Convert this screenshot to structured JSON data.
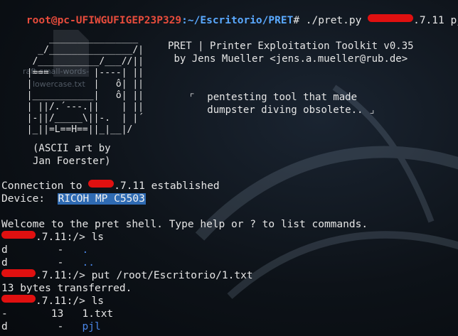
{
  "prompt": {
    "user_host": "root@pc-UFIWGUFIGEP23P329",
    "path": ":~/Escritorio/PRET",
    "symbol": "#",
    "command": "./pret.py",
    "ip_suffix": ".7.11",
    "protocol": "pjl"
  },
  "banner": {
    "title": "PRET | Printer Exploitation Toolkit v0.35",
    "author": "by Jens Mueller <jens.a.mueller@rub.de>",
    "tagline_1": "pentesting tool that made",
    "tagline_2": "dumpster diving obsolete.."
  },
  "ascii_credit": {
    "line1": "(ASCII art by",
    "line2": "Jan Foerster)"
  },
  "desktop_ghost": {
    "file1": "raft-small-words-",
    "file2": "lowercase.txt"
  },
  "connection": {
    "prefix": "Connection to",
    "ip_suffix": ".7.11",
    "status": "established",
    "device_label": "Device:",
    "device_name": "RICOH MP C5503"
  },
  "welcome": "Welcome to the pret shell. Type help or ? to list commands.",
  "session": {
    "shell_prompt": ".7.11:/>",
    "cmd1": "ls",
    "ls1_rows": [
      {
        "type": "d",
        "size": "-",
        "name": "."
      },
      {
        "type": "d",
        "size": "-",
        "name": ".."
      }
    ],
    "cmd2": "put /root/Escritorio/1.txt",
    "transfer_msg": "13 bytes transferred.",
    "cmd3": "ls",
    "ls2_rows": [
      {
        "type": "-",
        "size": "13",
        "name": "1.txt"
      },
      {
        "type": "d",
        "size": "-",
        "name": "pjl"
      }
    ]
  },
  "colors": {
    "prompt_user": "#e74c3c",
    "prompt_path": "#5aa9ff",
    "redaction": "#e01010",
    "highlight": "#2f6bb3",
    "directory": "#4a86e8"
  }
}
